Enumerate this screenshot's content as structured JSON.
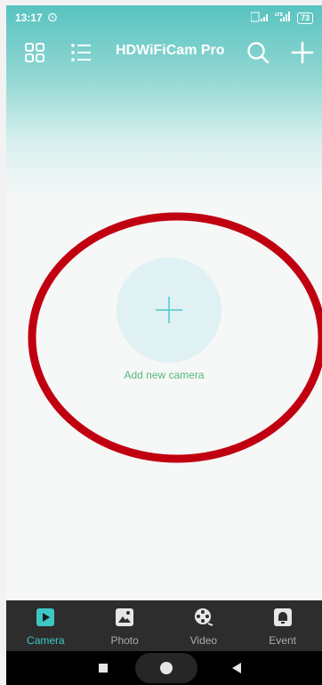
{
  "status_bar": {
    "time": "13:17",
    "network": "LTE",
    "battery": "73"
  },
  "app_bar": {
    "title": "HDWiFiCam Pro",
    "icons": [
      "grid-icon",
      "list-icon",
      "search-icon",
      "plus-icon"
    ]
  },
  "main": {
    "add_camera_label": "Add new camera",
    "annotation_color": "#c00010"
  },
  "tabs": [
    {
      "label": "Camera",
      "icon": "camera-play-icon",
      "active": true
    },
    {
      "label": "Photo",
      "icon": "photo-icon",
      "active": false
    },
    {
      "label": "Video",
      "icon": "video-reel-icon",
      "active": false
    },
    {
      "label": "Event",
      "icon": "bell-icon",
      "active": false
    }
  ],
  "colors": {
    "accent": "#3ec6c6",
    "header": "#58c3c0",
    "add_label": "#55bb77",
    "tab_bar": "#2d2d2d"
  }
}
